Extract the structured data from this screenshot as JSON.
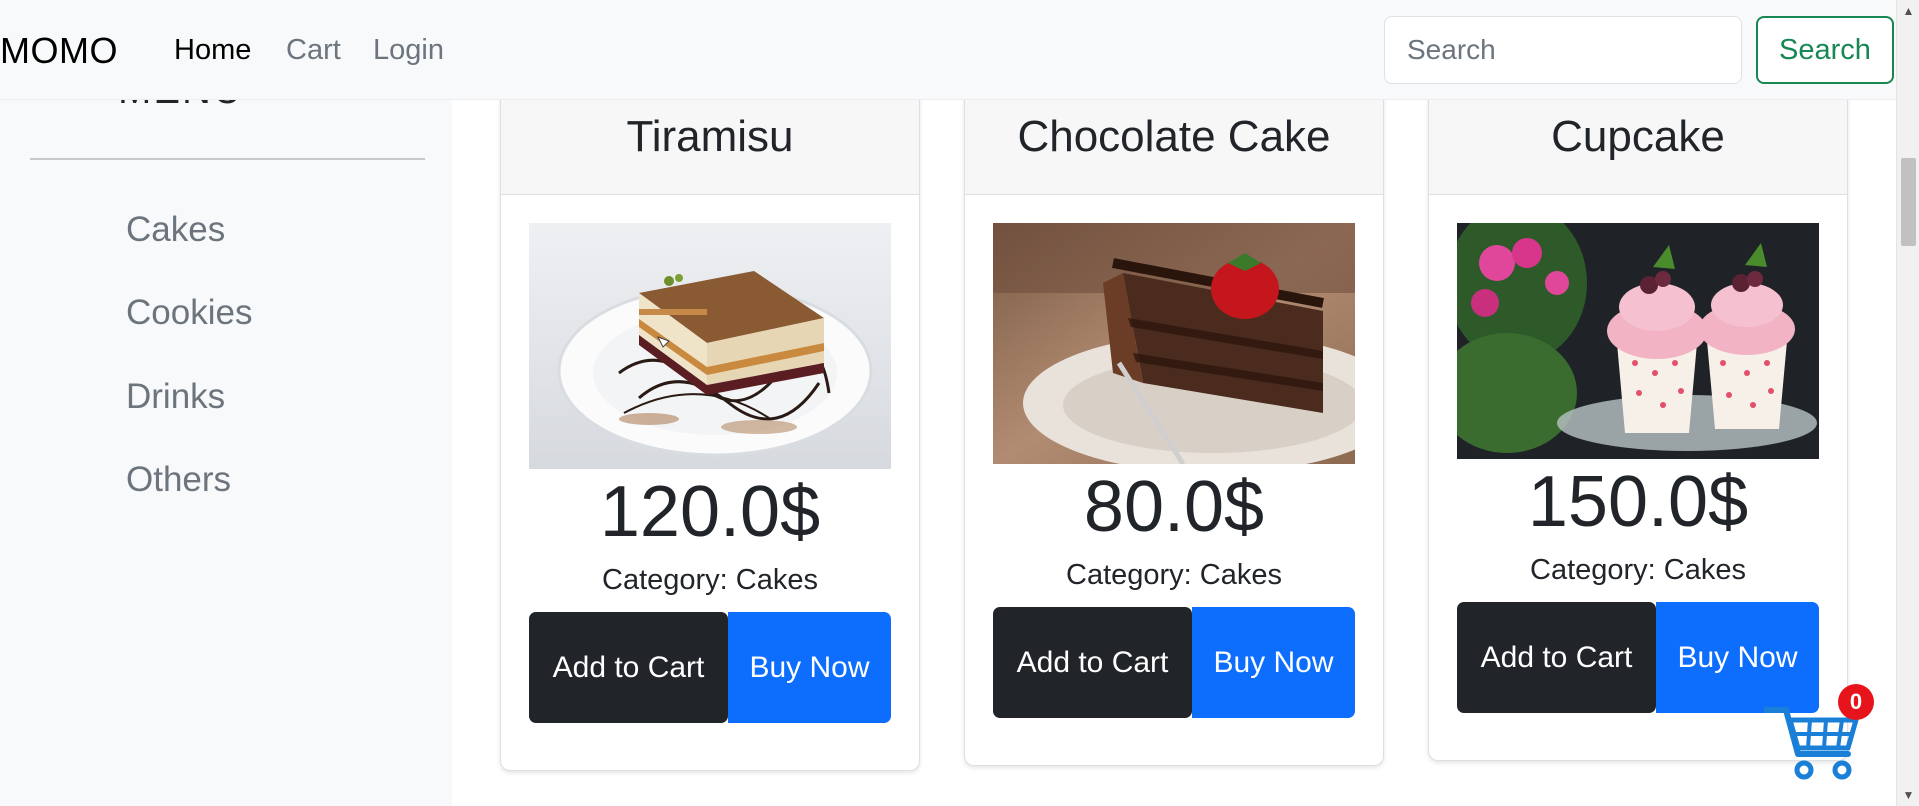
{
  "navbar": {
    "brand": "MOMO",
    "links": [
      {
        "label": "Home"
      },
      {
        "label": "Cart"
      },
      {
        "label": "Login"
      }
    ],
    "search": {
      "placeholder": "Search",
      "value": "",
      "button_label": "Search"
    }
  },
  "sidebar": {
    "title": "MENU",
    "items": [
      {
        "label": "Cakes"
      },
      {
        "label": "Cookies"
      },
      {
        "label": "Drinks"
      },
      {
        "label": "Others"
      }
    ]
  },
  "products": [
    {
      "name": "Tiramisu",
      "price": "120.0$",
      "category": "Category: Cakes",
      "add_label": "Add to Cart",
      "buy_label": "Buy Now"
    },
    {
      "name": "Chocolate Cake",
      "price": "80.0$",
      "category": "Category: Cakes",
      "add_label": "Add to Cart",
      "buy_label": "Buy Now"
    },
    {
      "name": "Cupcake",
      "price": "150.0$",
      "category": "Category: Cakes",
      "add_label": "Add to Cart",
      "buy_label": "Buy Now"
    }
  ],
  "floating_cart": {
    "count": "0",
    "icon": "shopping-cart-icon"
  },
  "colors": {
    "buy": "#0d6efd",
    "add": "#212529",
    "search_button": "#198754",
    "badge": "#e8141c"
  }
}
